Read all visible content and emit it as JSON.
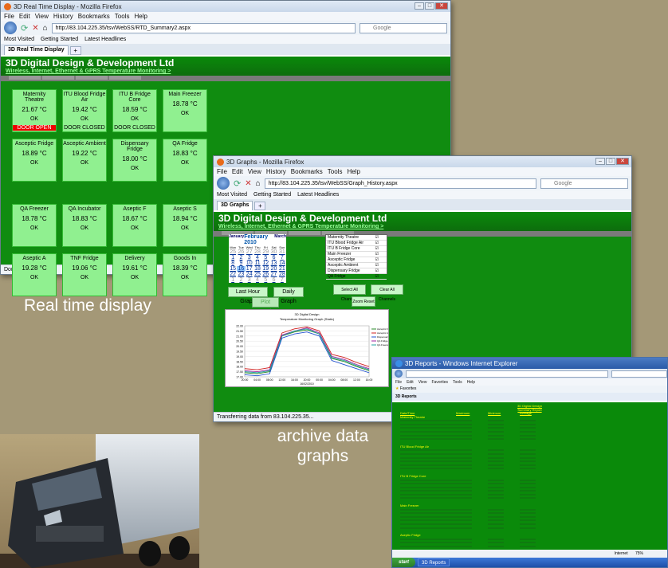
{
  "win1": {
    "title": "3D Real Time Display - Mozilla Firefox",
    "menu": [
      "File",
      "Edit",
      "View",
      "History",
      "Bookmarks",
      "Tools",
      "Help"
    ],
    "url": "http://83.104.225.35/tsv/WebSS/RTD_Summary2.aspx",
    "search_placeholder": "Google",
    "bookmarks": [
      "Most Visited",
      "Getting Started",
      "Latest Headlines"
    ],
    "tab": "3D Real Time Display",
    "site_title": "3D Digital Design & Development Ltd",
    "site_sub": "Wireless, Internet, Ethernet & GPRS Temperature Monitoring >",
    "status": "Done",
    "cells": [
      {
        "name": "Maternity Theatre",
        "temp": "21.67 °C",
        "state": "OK",
        "extra": "DOOR OPEN",
        "alarm": true
      },
      {
        "name": "ITU Blood Fridge Air",
        "temp": "19.42 °C",
        "state": "OK",
        "extra": "DOOR CLOSED",
        "alarm": false
      },
      {
        "name": "ITU B Fridge Core",
        "temp": "18.59 °C",
        "state": "OK",
        "extra": "DOOR CLOSED",
        "alarm": false
      },
      {
        "name": "Main Freezer",
        "temp": "18.78 °C",
        "state": "OK",
        "extra": "",
        "alarm": false
      },
      {
        "name": "Asceptic Fridge",
        "temp": "18.89 °C",
        "state": "OK",
        "extra": "",
        "alarm": false
      },
      {
        "name": "Asceptic Ambient",
        "temp": "19.22 °C",
        "state": "OK",
        "extra": "",
        "alarm": false
      },
      {
        "name": "Dispensary Fridge",
        "temp": "18.00 °C",
        "state": "OK",
        "extra": "",
        "alarm": false
      },
      {
        "name": "QA Fridge",
        "temp": "18.83 °C",
        "state": "OK",
        "extra": "",
        "alarm": false
      },
      {
        "name": "QA Freezer",
        "temp": "18.78 °C",
        "state": "OK",
        "extra": "",
        "alarm": false
      },
      {
        "name": "QA Incubator",
        "temp": "18.83 °C",
        "state": "OK",
        "extra": "",
        "alarm": false
      },
      {
        "name": "Aseptic F",
        "temp": "18.67 °C",
        "state": "OK",
        "extra": "",
        "alarm": false
      },
      {
        "name": "Aseptic S",
        "temp": "18.94 °C",
        "state": "OK",
        "extra": "",
        "alarm": false
      },
      {
        "name": "Aseptic A",
        "temp": "19.28 °C",
        "state": "OK",
        "extra": "",
        "alarm": false
      },
      {
        "name": "TNF Fridge",
        "temp": "19.06 °C",
        "state": "OK",
        "extra": "",
        "alarm": false
      },
      {
        "name": "Delivery",
        "temp": "19.61 °C",
        "state": "OK",
        "extra": "",
        "alarm": false
      },
      {
        "name": "Goods In",
        "temp": "18.39 °C",
        "state": "OK",
        "extra": "",
        "alarm": false
      }
    ]
  },
  "win2": {
    "title": "3D Graphs - Mozilla Firefox",
    "menu": [
      "File",
      "Edit",
      "View",
      "History",
      "Bookmarks",
      "Tools",
      "Help"
    ],
    "url": "http://83.104.225.35/tsv/WebSS/Graph_History.aspx",
    "search_placeholder": "Google",
    "bookmarks": [
      "Most Visited",
      "Getting Started",
      "Latest Headlines"
    ],
    "tab": "3D Graphs",
    "site_title": "3D Digital Design & Development Ltd",
    "site_sub": "Wireless, Internet, Ethernet & GPRS Temperature Monitoring >",
    "cal_month": "February 2010",
    "cal_prev": "January",
    "cal_next": "March",
    "cal_days": [
      "Mon",
      "Tue",
      "Wed",
      "Thu",
      "Fri",
      "Sat",
      "Sun"
    ],
    "cal_rows": [
      [
        "25",
        "26",
        "27",
        "28",
        "29",
        "30",
        "31"
      ],
      [
        "1",
        "2",
        "3",
        "4",
        "5",
        "6",
        "7"
      ],
      [
        "8",
        "9",
        "10",
        "11",
        "12",
        "13",
        "14"
      ],
      [
        "15",
        "16",
        "17",
        "18",
        "19",
        "20",
        "21"
      ],
      [
        "22",
        "23",
        "24",
        "25",
        "26",
        "27",
        "28"
      ],
      [
        "1",
        "2",
        "3",
        "4",
        "5",
        "6",
        "7"
      ]
    ],
    "channels": [
      "Maternity Theatre",
      "ITU Blood Fridge Air",
      "ITU B Fridge Core",
      "Main Freezer",
      "Asceptic Fridge",
      "Asceptic Ambient",
      "Dispensary Fridge",
      "QA Fridge"
    ],
    "btn_last": "Last Hour Graph",
    "btn_daily": "Daily Graph",
    "btn_plot": "Plot Graph",
    "btn_select": "Select All Channels",
    "btn_clear": "Clear All Channels",
    "btn_zoom": "Zoom Reset",
    "chart_title": "3D Digital Design",
    "chart_sub": "Temperature Monitoring Graph (Static)",
    "status": "Transferring data from 83.104.225.35..."
  },
  "win3": {
    "title": "3D Reports - Windows Internet Explorer",
    "menu": [
      "File",
      "Edit",
      "View",
      "Favorites",
      "Tools",
      "Help"
    ],
    "favorites": "Favorites",
    "tab": "3D Reports",
    "report_title": "3D Digital Design",
    "report_sub": "Summary Report",
    "cols": [
      "Date/Time",
      "Maximum",
      "Minimum",
      "Average"
    ],
    "sections": [
      "Maternity Theatre",
      "ITU Blood Fridge Air",
      "ITU B Fridge Core",
      "Main Freezer",
      "Aseptic Fridge",
      "Aseptic Ambient"
    ],
    "status": "Internet",
    "zoom": "75%",
    "start": "start"
  },
  "captions": {
    "realtime": "Real time display",
    "archive": "archive data graphs"
  },
  "chart_data": {
    "type": "line",
    "title": "3D Digital Design",
    "subtitle": "Temperature Monitoring Graph (Static)",
    "ylim": [
      17.0,
      22.0
    ],
    "yticks": [
      "22.00",
      "21.50",
      "21.00",
      "20.50",
      "20.00",
      "19.50",
      "19.00",
      "18.50",
      "18.00",
      "17.50",
      "17.00"
    ],
    "xticks": [
      "20:00",
      "04:00",
      "08:00",
      "12:00",
      "16:00",
      "20:00",
      "00:00",
      "04:00",
      "08:00",
      "12:00",
      "16:00"
    ],
    "xlabel": "16/02/2010",
    "series": [
      {
        "name": "Asceptic Fridge",
        "color": "#2b8a2b",
        "values": [
          17.4,
          17.3,
          17.5,
          21.0,
          21.4,
          21.6,
          21.2,
          18.8,
          18.5,
          18.0,
          17.6
        ]
      },
      {
        "name": "Asceptic Ambient",
        "color": "#d02020",
        "values": [
          17.8,
          17.7,
          17.9,
          21.3,
          21.7,
          21.9,
          21.5,
          19.2,
          18.9,
          18.4,
          18.0
        ]
      },
      {
        "name": "Dispensary Fridge",
        "color": "#2050d0",
        "values": [
          17.2,
          17.1,
          17.3,
          20.8,
          21.2,
          21.4,
          21.0,
          18.6,
          18.2,
          17.8,
          17.4
        ]
      },
      {
        "name": "QA Fridge",
        "color": "#a020a0",
        "values": [
          17.6,
          17.5,
          17.7,
          21.1,
          21.5,
          21.8,
          21.3,
          19.0,
          18.7,
          18.2,
          17.8
        ]
      },
      {
        "name": "QA Freezer",
        "color": "#20a0a0",
        "values": [
          17.5,
          17.4,
          17.6,
          21.0,
          21.5,
          21.7,
          21.2,
          18.9,
          18.6,
          18.1,
          17.7
        ]
      }
    ]
  }
}
